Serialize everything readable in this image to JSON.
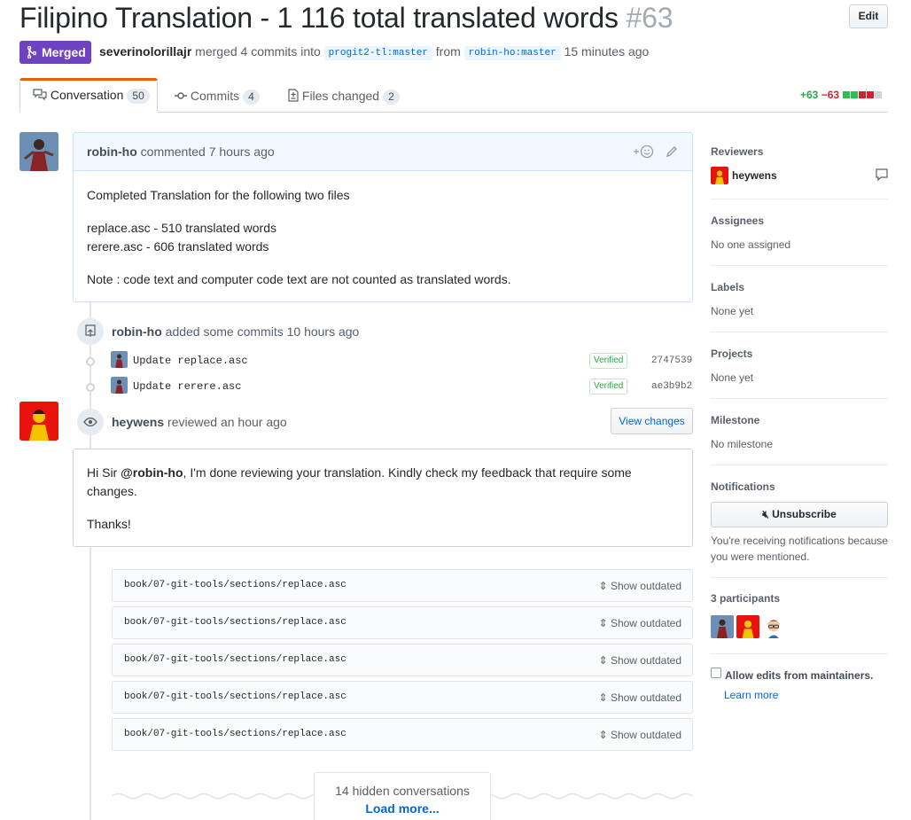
{
  "pr": {
    "title": "Filipino Translation - 1 116 total translated words",
    "number": "#63",
    "edit_label": "Edit",
    "state_label": "Merged",
    "merger": "severinolorillajr",
    "merged_text": "merged 4 commits into",
    "base_branch": "progit2-tl:master",
    "from_text": "from",
    "head_branch": "robin-ho:master",
    "time": "15 minutes ago"
  },
  "tabs": [
    {
      "label": "Conversation",
      "count": "50",
      "icon": "comment-discussion-icon"
    },
    {
      "label": "Commits",
      "count": "4",
      "icon": "git-commit-icon"
    },
    {
      "label": "Files changed",
      "count": "2",
      "icon": "file-diff-icon"
    }
  ],
  "diffstat": {
    "additions": "+63",
    "deletions": "−63"
  },
  "timeline": {
    "first_comment": {
      "author": "robin-ho",
      "action": "commented",
      "time": "7 hours ago",
      "line1": "Completed Translation for the following two files",
      "line2": "replace.asc - 510 translated words",
      "line3": "rerere.asc - 606 translated words",
      "line4": "Note : code text and computer code text are not counted as translated words."
    },
    "commit_event": {
      "author": "robin-ho",
      "action": "added some commits",
      "time": "10 hours ago",
      "commits": [
        {
          "message": "Update replace.asc",
          "verified": "Verified",
          "sha": "2747539"
        },
        {
          "message": "Update rerere.asc",
          "verified": "Verified",
          "sha": "ae3b9b2"
        }
      ]
    },
    "review": {
      "author": "heywens",
      "action": "reviewed",
      "time": "an hour ago",
      "view_changes": "View changes",
      "body_pre": "Hi Sir ",
      "mention": "@robin-ho",
      "body_post": ", I'm done reviewing your translation. Kindly check my feedback that require some changes.",
      "thanks": "Thanks!"
    },
    "outdated_files": [
      {
        "path": "book/07-git-tools/sections/replace.asc",
        "action": "Show outdated"
      },
      {
        "path": "book/07-git-tools/sections/replace.asc",
        "action": "Show outdated"
      },
      {
        "path": "book/07-git-tools/sections/replace.asc",
        "action": "Show outdated"
      },
      {
        "path": "book/07-git-tools/sections/replace.asc",
        "action": "Show outdated"
      },
      {
        "path": "book/07-git-tools/sections/replace.asc",
        "action": "Show outdated"
      }
    ],
    "hidden": {
      "text": "14 hidden conversations",
      "load_more": "Load more..."
    }
  },
  "sidebar": {
    "reviewers_h": "Reviewers",
    "reviewer": "heywens",
    "assignees_h": "Assignees",
    "assignees_v": "No one assigned",
    "labels_h": "Labels",
    "labels_v": "None yet",
    "projects_h": "Projects",
    "projects_v": "None yet",
    "milestone_h": "Milestone",
    "milestone_v": "No milestone",
    "notifications_h": "Notifications",
    "unsubscribe": "Unsubscribe",
    "notif_reason": "You're receiving notifications because you were mentioned.",
    "participants_h": "3 participants",
    "allow_edits": "Allow edits from maintainers.",
    "learn_more": "Learn more"
  },
  "colors": {
    "merged": "#6f42c1",
    "addition": "#28a745",
    "deletion": "#cb2431",
    "link": "#0366d6"
  }
}
